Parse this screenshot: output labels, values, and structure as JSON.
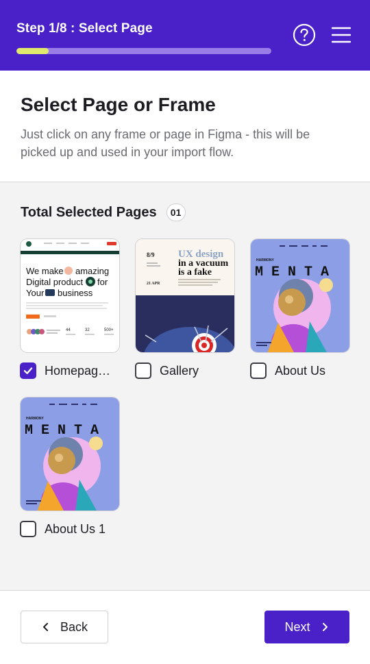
{
  "header": {
    "step_title": "Step 1/8 : Select Page",
    "progress_fraction": 0.125,
    "help_icon": "help-circle-icon",
    "menu_icon": "hamburger-menu-icon"
  },
  "intro": {
    "heading": "Select Page or Frame",
    "description": "Just click on any frame or page in Figma - this will be picked up and used in your import flow."
  },
  "selection": {
    "count_label": "Total Selected Pages",
    "count_value": "01"
  },
  "pages": [
    {
      "label": "Homepag…",
      "checked": true
    },
    {
      "label": "Gallery",
      "checked": false
    },
    {
      "label": "About Us",
      "checked": false
    },
    {
      "label": "About Us 1",
      "checked": false
    }
  ],
  "thumbs": {
    "homepage": {
      "headline_1": "We make",
      "headline_2": "amazing",
      "headline_3": "Digital product",
      "headline_4": "for",
      "headline_5": "Your",
      "headline_6": "business",
      "stat_1": "44",
      "stat_2": "32",
      "stat_3": "500+"
    },
    "gallery": {
      "date_top": "8/9",
      "title_1": "UX design",
      "title_2": "in a vacuum",
      "title_3": "is a fake",
      "date_bottom": "21 APR"
    },
    "about": {
      "brand_small": "HARMONY",
      "brand_big": "M E N T A"
    }
  },
  "footer": {
    "back_label": "Back",
    "next_label": "Next"
  },
  "colors": {
    "brand": "#4a21c9",
    "progress_fill": "#e1e86e",
    "progress_track": "#9a7ce6"
  }
}
